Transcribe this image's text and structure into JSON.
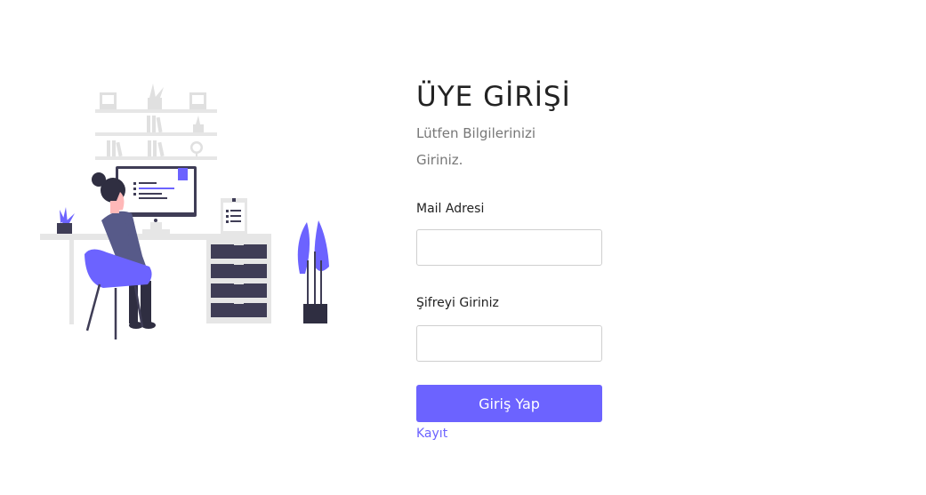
{
  "colors": {
    "accent": "#6c63ff",
    "text": "#222222",
    "muted": "#777777",
    "border": "#cfcfcf"
  },
  "illustration": {
    "name": "workspace-illustration"
  },
  "form": {
    "title": "ÜYE GİRİŞİ",
    "subtitle": "Lütfen Bilgilerinizi Giriniz.",
    "email_label": "Mail Adresi",
    "email_value": "",
    "password_label": "Şifreyi Giriniz",
    "password_value": "",
    "submit_label": "Giriş Yap",
    "register_link": "Kayıt"
  }
}
